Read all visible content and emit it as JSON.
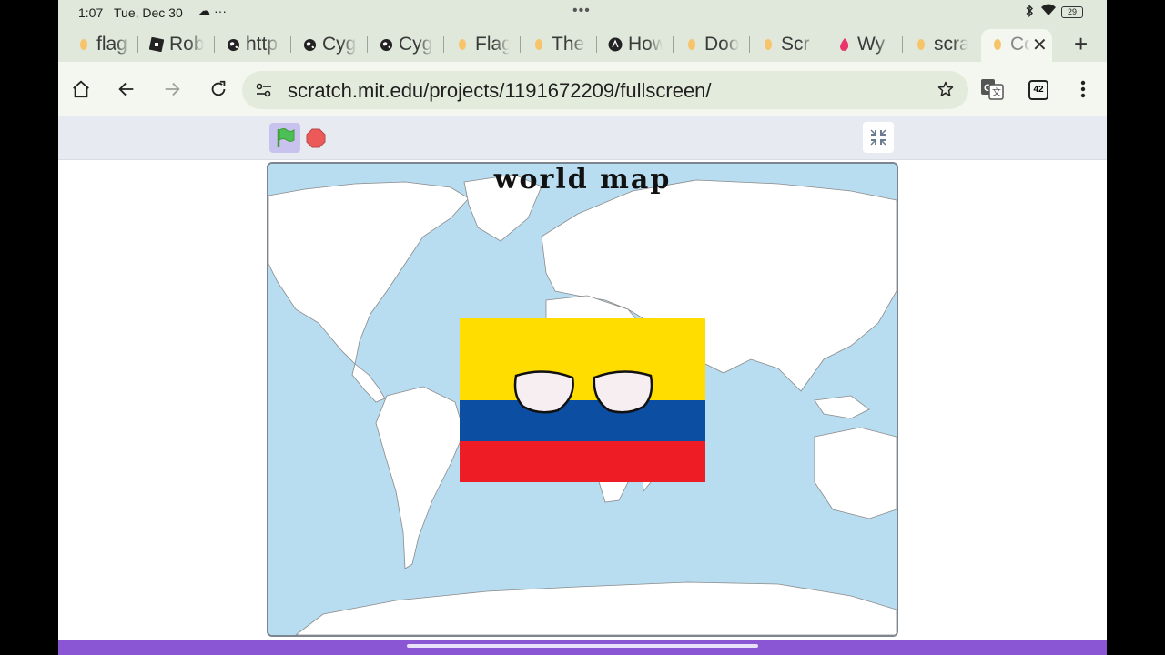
{
  "status_bar": {
    "time": "1:07",
    "date": "Tue, Dec 30",
    "more": "···",
    "center": "•••",
    "battery": "29"
  },
  "tabs": [
    {
      "label": "flag",
      "icon": "scratch-cat-icon"
    },
    {
      "label": "Rob",
      "icon": "roblox-icon"
    },
    {
      "label": "http",
      "icon": "globe-icon"
    },
    {
      "label": "Cyg",
      "icon": "globe-icon"
    },
    {
      "label": "Cyg",
      "icon": "globe-icon"
    },
    {
      "label": "Flag",
      "icon": "scratch-cat-icon"
    },
    {
      "label": "The",
      "icon": "scratch-cat-icon"
    },
    {
      "label": "How",
      "icon": "ai-icon"
    },
    {
      "label": "Doo",
      "icon": "scratch-cat-icon"
    },
    {
      "label": "Scr",
      "icon": "scratch-cat-icon"
    },
    {
      "label": "Wy",
      "icon": "fire-icon"
    },
    {
      "label": "scra",
      "icon": "scratch-cat-icon"
    }
  ],
  "active_tab": {
    "label": "Co",
    "icon": "scratch-cat-icon"
  },
  "omnibox": {
    "url": "scratch.mit.edu/projects/1191672209/fullscreen/"
  },
  "tab_count": "42",
  "stage": {
    "title": "world map"
  },
  "colors": {
    "flag_yellow": "#ffdd00",
    "flag_blue": "#0b4ea2",
    "flag_red": "#ee1c25",
    "ocean": "#b8dcf0",
    "scratch_purple": "#8a56d4"
  }
}
